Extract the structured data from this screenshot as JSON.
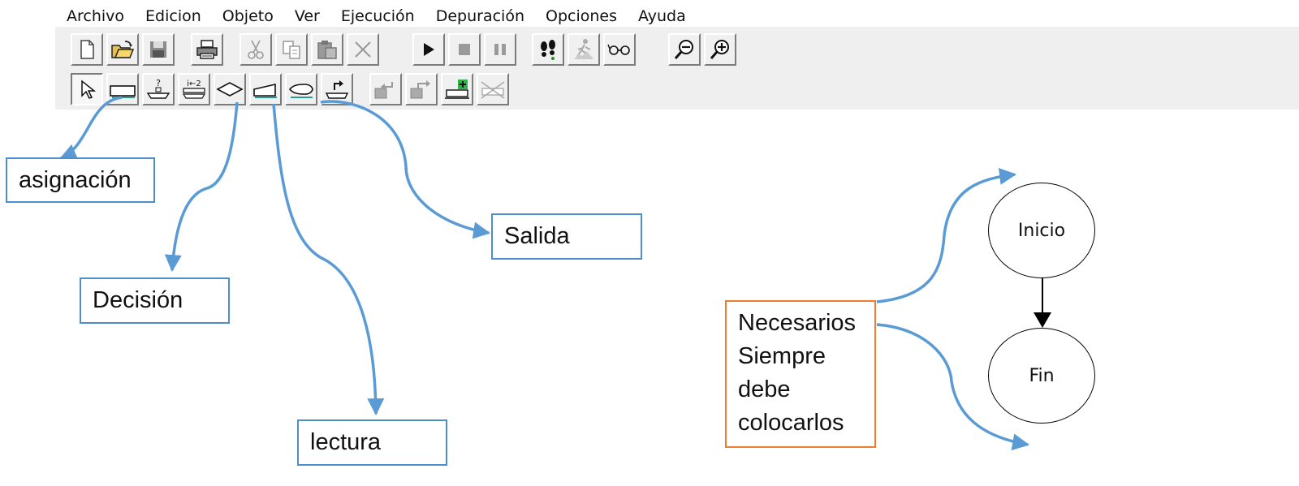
{
  "menu": [
    "Archivo",
    "Edicion",
    "Objeto",
    "Ver",
    "Ejecución",
    "Depuración",
    "Opciones",
    "Ayuda"
  ],
  "callouts": {
    "asignacion": "asignación",
    "decision": "Decisión",
    "lectura": "lectura",
    "salida": "Salida"
  },
  "note": {
    "lines": [
      "Necesarios",
      "Siempre",
      "debe",
      "colocarlos"
    ]
  },
  "flow": {
    "start": "Inicio",
    "end": "Fin"
  },
  "toolbar": {
    "row1": [
      "new-file-icon",
      "open-folder-icon",
      "save-disk-icon",
      "print-icon",
      "cut-icon",
      "copy-icon",
      "paste-icon",
      "delete-icon",
      "run-icon",
      "stop-icon",
      "pause-icon",
      "step-footprints-icon",
      "step-runner-icon",
      "watch-glasses-icon",
      "zoom-out-icon",
      "zoom-in-icon"
    ],
    "row2": [
      "select-arrow-icon",
      "assignment-shape-icon",
      "input-shape-icon",
      "loop-shape-icon",
      "decision-shape-icon",
      "read-shape-icon",
      "output-shape-icon",
      "call-shape-icon",
      "move-left-icon",
      "move-right-icon",
      "add-block-icon",
      "remove-block-icon"
    ]
  },
  "colors": {
    "callout_border": "#4f8fc9",
    "arrow": "#5b9bd5",
    "note_border": "#ed7d31"
  }
}
